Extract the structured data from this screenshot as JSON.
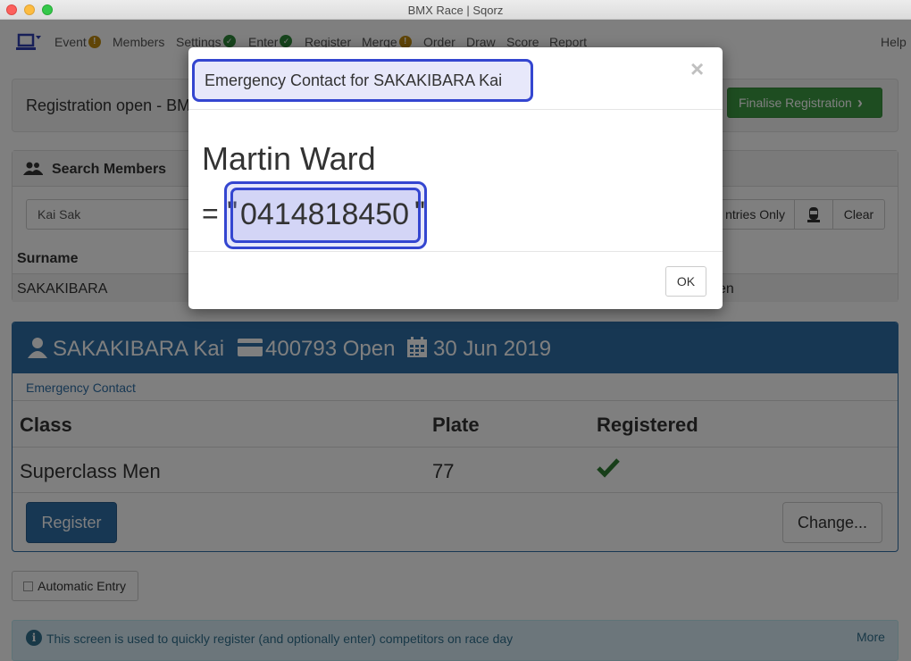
{
  "window": {
    "title": "BMX Race | Sqorz"
  },
  "nav": {
    "items": [
      {
        "label": "Event",
        "badge": "!"
      },
      {
        "label": "Members"
      },
      {
        "label": "Settings",
        "badge": "✓"
      },
      {
        "label": "Enter",
        "badge": "✓"
      },
      {
        "label": "Register"
      },
      {
        "label": "Merge",
        "badge": "!"
      },
      {
        "label": "Order"
      },
      {
        "label": "Draw"
      },
      {
        "label": "Score"
      },
      {
        "label": "Report"
      }
    ],
    "help": "Help"
  },
  "registration": {
    "status": "Registration open - BMX",
    "finalise_label": "Finalise Registration"
  },
  "search": {
    "title": "Search Members",
    "query": "Kai Sak",
    "entries_only_label": "ntries Only",
    "clear_label": "Clear",
    "surname_header": "Surname",
    "result_surname": "SAKAKIBARA",
    "result_class": "en"
  },
  "member": {
    "name": "SAKAKIBARA Kai",
    "licence": "400793 Open",
    "date": "30 Jun 2019",
    "emergency_link": "Emergency Contact",
    "table": {
      "headers": {
        "class": "Class",
        "plate": "Plate",
        "registered": "Registered"
      },
      "rows": [
        {
          "class": "Superclass Men",
          "plate": "77",
          "registered": "✓"
        }
      ]
    },
    "register_label": "Register",
    "change_label": "Change..."
  },
  "auto_entry_label": "Automatic Entry",
  "info": {
    "text": "This screen is used to quickly register (and optionally enter) competitors on race day",
    "more": "More"
  },
  "modal": {
    "title": "Emergency Contact for SAKAKIBARA Kai",
    "contact_name": "Martin Ward",
    "prefix": "=",
    "quote_open": "\"",
    "phone": "0414818450",
    "quote_close": "\"",
    "ok_label": "OK",
    "close_symbol": "×"
  },
  "colors": {
    "primary": "#2f6fa6",
    "success": "#3c9b43",
    "highlight": "#3446d0",
    "info_bg": "#d9edf7"
  },
  "icons": {
    "logo": "laptop-icon",
    "search_members": "users-icon",
    "member": "user-icon",
    "licence": "credit-card-icon",
    "date": "calendar-icon",
    "info": "info-icon"
  }
}
